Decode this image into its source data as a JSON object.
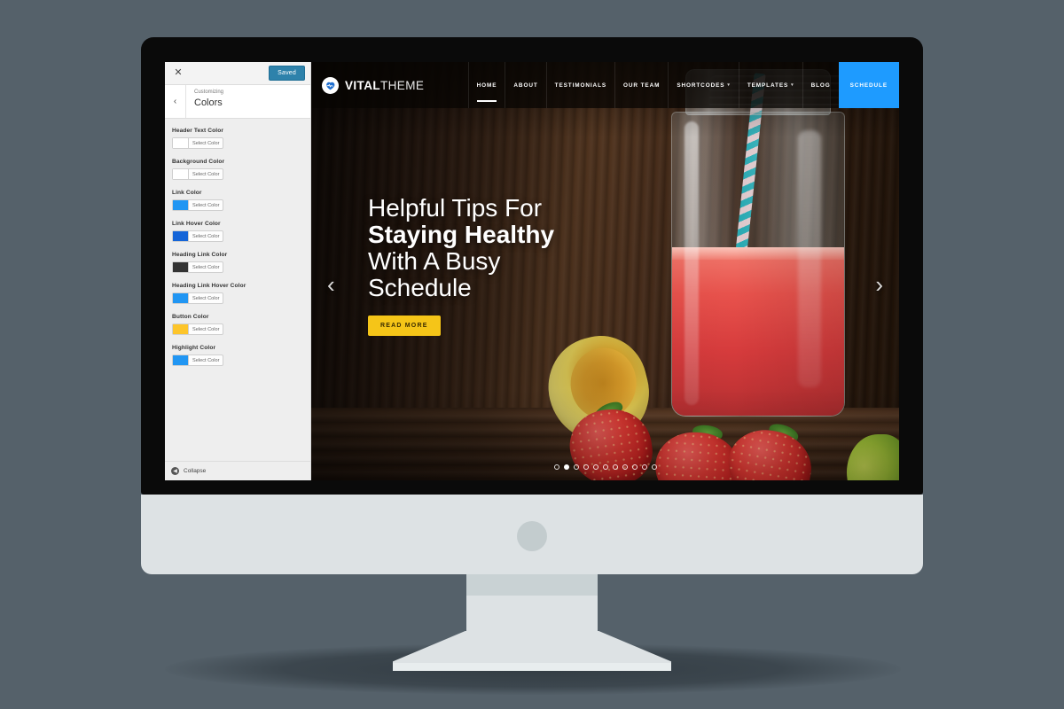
{
  "theme_colors": {
    "background": "#55616a",
    "monitor_bezel": "#0a0a0a",
    "monitor_chin": "#dde2e4",
    "accent_blue": "#1e9bff",
    "saved_blue": "#2e82ab",
    "button_yellow": "#f5c518"
  },
  "customizer": {
    "close_icon": "✕",
    "saved_label": "Saved",
    "back_icon": "‹",
    "eyebrow": "Customizing",
    "title": "Colors",
    "select_color_label": "Select Color",
    "collapse_label": "Collapse",
    "collapse_icon": "◀",
    "controls": [
      {
        "label": "Header Text Color",
        "swatch": "#ffffff"
      },
      {
        "label": "Background Color",
        "swatch": "#ffffff"
      },
      {
        "label": "Link Color",
        "swatch": "#2196f3"
      },
      {
        "label": "Link Hover Color",
        "swatch": "#1565d8"
      },
      {
        "label": "Heading Link Color",
        "swatch": "#333333"
      },
      {
        "label": "Heading Link Hover Color",
        "swatch": "#2196f3"
      },
      {
        "label": "Button Color",
        "swatch": "#fdc52a"
      },
      {
        "label": "Highlight Color",
        "swatch": "#2196f3"
      }
    ]
  },
  "site": {
    "brand": {
      "strong": "VITAL",
      "light": "THEME",
      "icon": "heart-pulse-icon"
    },
    "nav": [
      {
        "label": "HOME",
        "active": true,
        "caret": false,
        "cta": false
      },
      {
        "label": "ABOUT",
        "active": false,
        "caret": false,
        "cta": false
      },
      {
        "label": "TESTIMONIALS",
        "active": false,
        "caret": false,
        "cta": false
      },
      {
        "label": "OUR TEAM",
        "active": false,
        "caret": false,
        "cta": false
      },
      {
        "label": "SHORTCODES",
        "active": false,
        "caret": true,
        "cta": false
      },
      {
        "label": "TEMPLATES",
        "active": false,
        "caret": true,
        "cta": false
      },
      {
        "label": "BLOG",
        "active": false,
        "caret": false,
        "cta": false
      },
      {
        "label": "SCHEDULE",
        "active": false,
        "caret": false,
        "cta": true
      }
    ],
    "hero": {
      "line1": "Helpful Tips For",
      "line2": "Staying Healthy",
      "line3": "With A Busy",
      "line4": "Schedule",
      "cta_label": "READ MORE",
      "prev_icon": "‹",
      "next_icon": "›",
      "dot_count": 11,
      "active_dot": 2
    }
  }
}
